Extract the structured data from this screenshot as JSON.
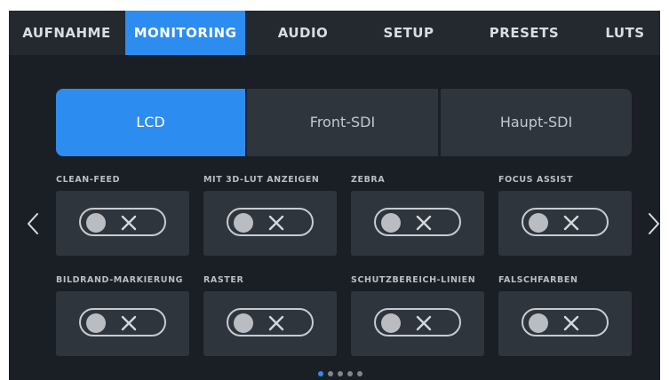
{
  "tabs": [
    {
      "label": "AUFNAHME"
    },
    {
      "label": "MONITORING"
    },
    {
      "label": "AUDIO"
    },
    {
      "label": "SETUP"
    },
    {
      "label": "PRESETS"
    },
    {
      "label": "LUTS"
    }
  ],
  "active_tab": "MONITORING",
  "outputs": [
    {
      "label": "LCD"
    },
    {
      "label": "Front-SDI"
    },
    {
      "label": "Haupt-SDI"
    }
  ],
  "selected_output": "LCD",
  "settings": [
    {
      "label": "CLEAN-FEED",
      "enabled": false
    },
    {
      "label": "MIT 3D-LUT ANZEIGEN",
      "enabled": false
    },
    {
      "label": "ZEBRA",
      "enabled": false
    },
    {
      "label": "FOCUS ASSIST",
      "enabled": false
    },
    {
      "label": "BILDRAND-MARKIERUNG",
      "enabled": false
    },
    {
      "label": "RASTER",
      "enabled": false
    },
    {
      "label": "SCHUTZBEREICH-LINIEN",
      "enabled": false
    },
    {
      "label": "FALSCHFARBEN",
      "enabled": false
    }
  ],
  "pagination": {
    "current_page": 1,
    "total_pages": 5
  },
  "colors": {
    "accent": "#2d8cf0",
    "background": "#1a1f25",
    "card": "#2e353d"
  },
  "icons": {
    "prev": "chevron-left-icon",
    "next": "chevron-right-icon",
    "toggle_off": "x-icon"
  }
}
